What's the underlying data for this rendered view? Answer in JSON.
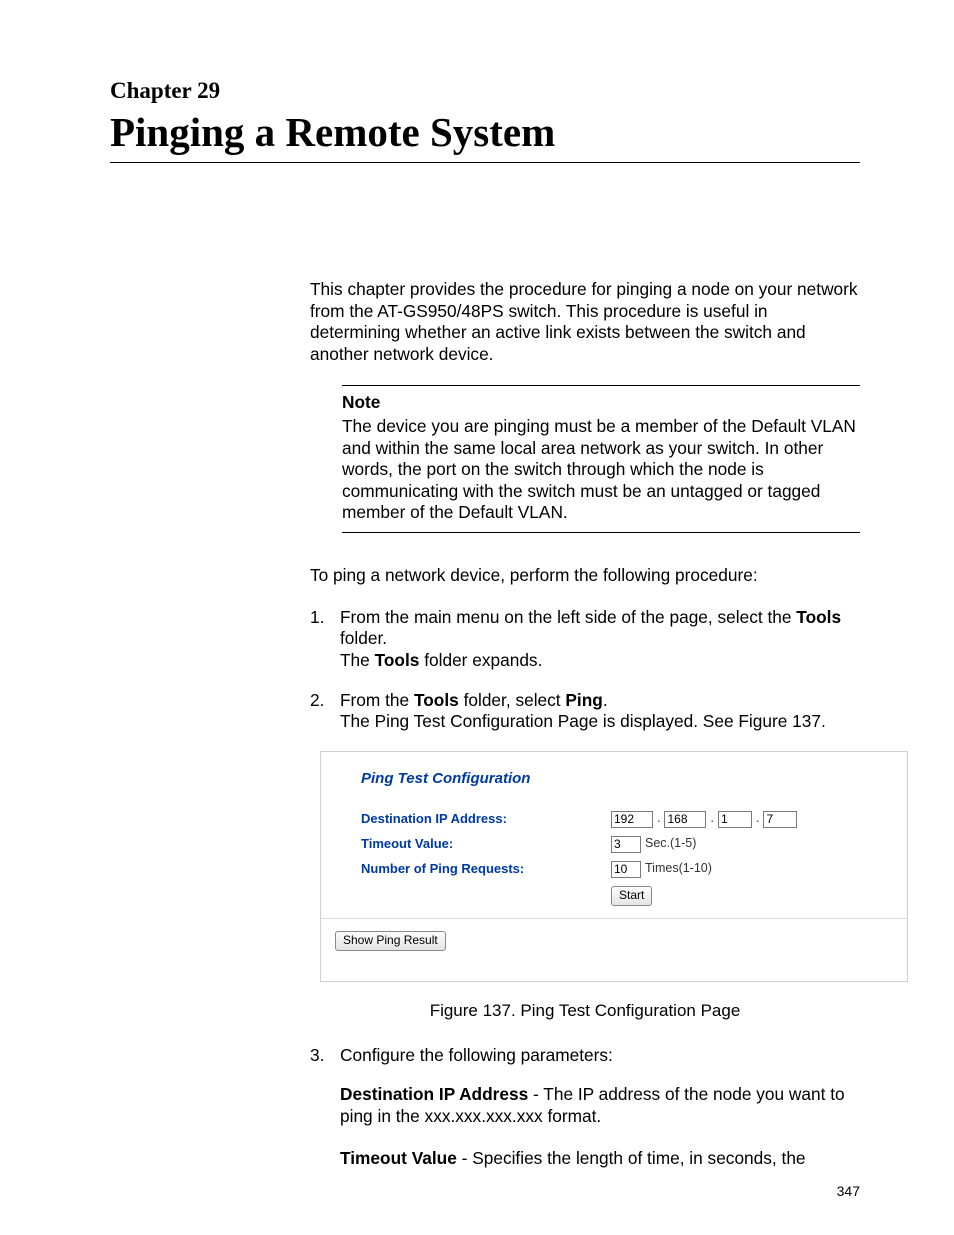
{
  "chapter": {
    "label": "Chapter 29",
    "title": "Pinging a Remote System"
  },
  "intro": "This chapter provides the procedure for pinging a node on your network from the AT-GS950/48PS switch. This procedure is useful in determining whether an active link exists between the switch and another network device.",
  "note": {
    "head": "Note",
    "body": "The device you are pinging must be a member of the Default VLAN and within the same local area network as your switch. In other words, the port on the switch through which the node is communicating with the switch must be an untagged or tagged member of the Default VLAN."
  },
  "lead": "To ping a network device, perform the following procedure:",
  "steps": {
    "s1": {
      "num": "1.",
      "a": "From the main menu on the left side of the page, select the ",
      "b": "Tools",
      "c": " folder.",
      "d1": "The ",
      "d2": "Tools",
      "d3": " folder expands."
    },
    "s2": {
      "num": "2.",
      "a": "From the ",
      "b": "Tools",
      "c": " folder, select ",
      "d": "Ping",
      "e": ".",
      "f": "The Ping Test Configuration Page is displayed. See Figure 137."
    },
    "s3": {
      "num": "3.",
      "a": "Configure the following parameters:"
    }
  },
  "shot": {
    "title": "Ping Test Configuration",
    "label_ip": "Destination IP Address:",
    "label_timeout": "Timeout Value:",
    "label_count": "Number of Ping Requests:",
    "ip": {
      "o1": "192",
      "o2": "168",
      "o3": "1",
      "o4": "7"
    },
    "timeout_val": "3",
    "timeout_unit": "Sec.(1-5)",
    "count_val": "10",
    "count_unit": "Times(1-10)",
    "start_btn": "Start",
    "result_btn": "Show Ping Result"
  },
  "figure_caption": "Figure 137. Ping Test Configuration Page",
  "params": {
    "p1b": "Destination IP Address",
    "p1": " - The IP address of the node you want to ping in the xxx.xxx.xxx.xxx format.",
    "p2b": "Timeout Value",
    "p2": " - Specifies the length of time, in seconds, the"
  },
  "page_num": "347"
}
